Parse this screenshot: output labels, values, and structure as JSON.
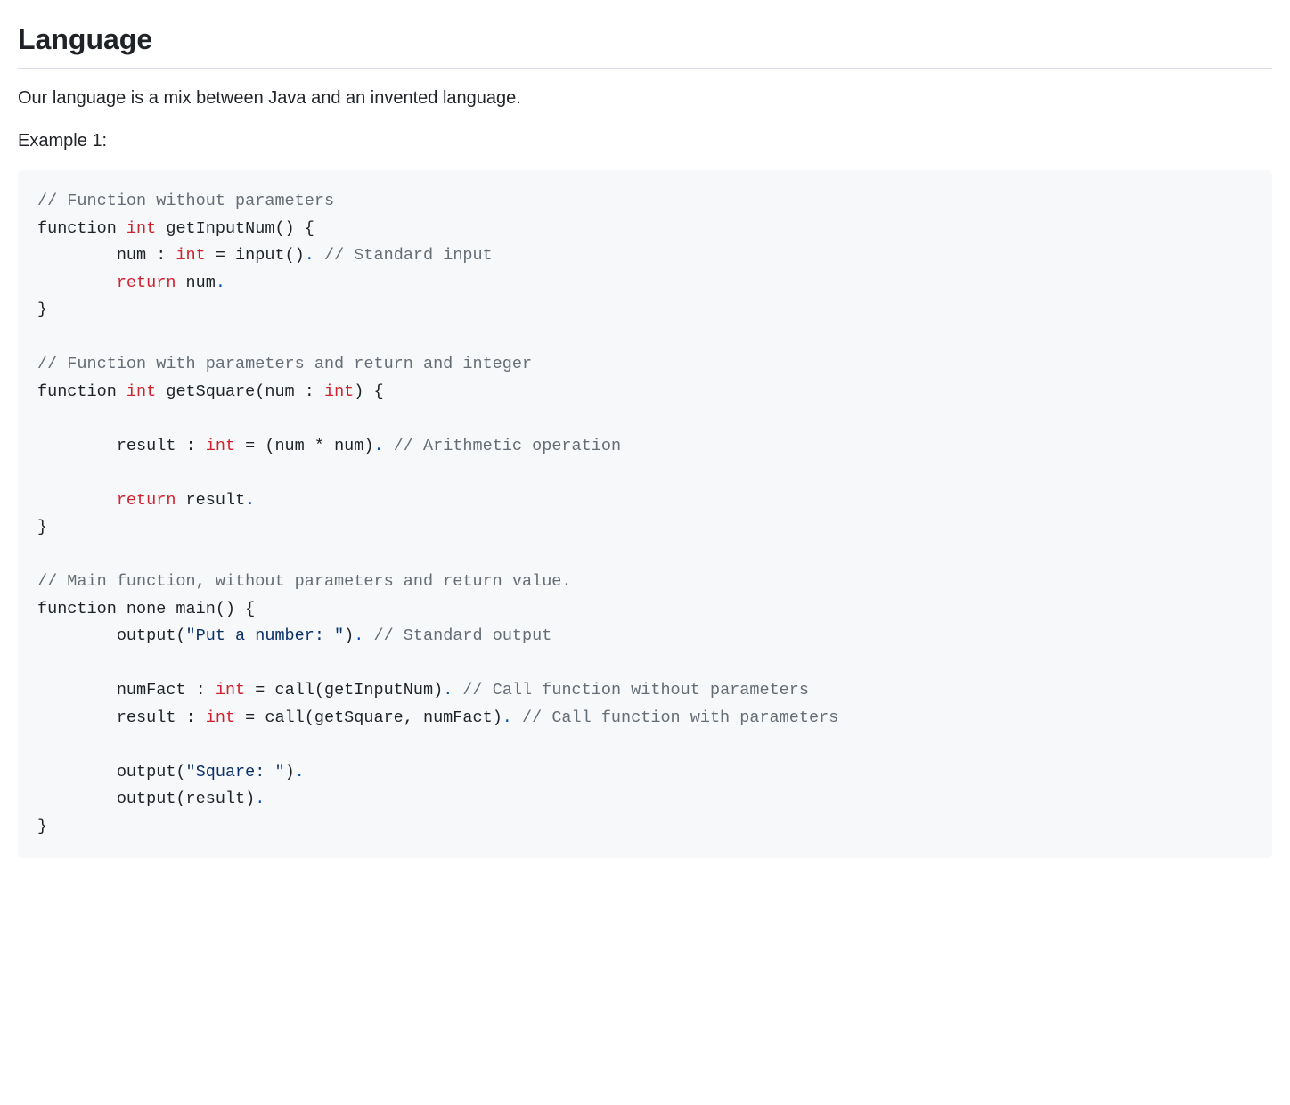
{
  "heading": "Language",
  "intro": "Our language is a mix between Java and an invented language.",
  "example_label": "Example 1:",
  "code": {
    "tokens": [
      {
        "cls": "tok-comment",
        "t": "// Function without parameters"
      },
      {
        "cls": null,
        "t": "\nfunction "
      },
      {
        "cls": "tok-keyword",
        "t": "int"
      },
      {
        "cls": null,
        "t": " getInputNum() {\n        num : "
      },
      {
        "cls": "tok-keyword",
        "t": "int"
      },
      {
        "cls": null,
        "t": " = input()"
      },
      {
        "cls": "tok-punct",
        "t": "."
      },
      {
        "cls": null,
        "t": " "
      },
      {
        "cls": "tok-comment",
        "t": "// Standard input"
      },
      {
        "cls": null,
        "t": "\n        "
      },
      {
        "cls": "tok-keyword",
        "t": "return"
      },
      {
        "cls": null,
        "t": " num"
      },
      {
        "cls": "tok-punct",
        "t": "."
      },
      {
        "cls": null,
        "t": "\n}\n\n"
      },
      {
        "cls": "tok-comment",
        "t": "// Function with parameters and return and integer"
      },
      {
        "cls": null,
        "t": "\nfunction "
      },
      {
        "cls": "tok-keyword",
        "t": "int"
      },
      {
        "cls": null,
        "t": " getSquare(num : "
      },
      {
        "cls": "tok-keyword",
        "t": "int"
      },
      {
        "cls": null,
        "t": ") {\n\n        result : "
      },
      {
        "cls": "tok-keyword",
        "t": "int"
      },
      {
        "cls": null,
        "t": " = (num * num)"
      },
      {
        "cls": "tok-punct",
        "t": "."
      },
      {
        "cls": null,
        "t": " "
      },
      {
        "cls": "tok-comment",
        "t": "// Arithmetic operation"
      },
      {
        "cls": null,
        "t": "\n\n        "
      },
      {
        "cls": "tok-keyword",
        "t": "return"
      },
      {
        "cls": null,
        "t": " result"
      },
      {
        "cls": "tok-punct",
        "t": "."
      },
      {
        "cls": null,
        "t": "\n}\n\n"
      },
      {
        "cls": "tok-comment",
        "t": "// Main function, without parameters and return value."
      },
      {
        "cls": null,
        "t": "\nfunction none main() {\n        output("
      },
      {
        "cls": "tok-string",
        "t": "\"Put a number: \""
      },
      {
        "cls": null,
        "t": ")"
      },
      {
        "cls": "tok-punct",
        "t": "."
      },
      {
        "cls": null,
        "t": " "
      },
      {
        "cls": "tok-comment",
        "t": "// Standard output"
      },
      {
        "cls": null,
        "t": "\n\n        numFact : "
      },
      {
        "cls": "tok-keyword",
        "t": "int"
      },
      {
        "cls": null,
        "t": " = call(getInputNum)"
      },
      {
        "cls": "tok-punct",
        "t": "."
      },
      {
        "cls": null,
        "t": " "
      },
      {
        "cls": "tok-comment",
        "t": "// Call function without parameters"
      },
      {
        "cls": null,
        "t": "\n        result : "
      },
      {
        "cls": "tok-keyword",
        "t": "int"
      },
      {
        "cls": null,
        "t": " = call(getSquare, numFact)"
      },
      {
        "cls": "tok-punct",
        "t": "."
      },
      {
        "cls": null,
        "t": " "
      },
      {
        "cls": "tok-comment",
        "t": "// Call function with parameters"
      },
      {
        "cls": null,
        "t": "\n\n        output("
      },
      {
        "cls": "tok-string",
        "t": "\"Square: \""
      },
      {
        "cls": null,
        "t": ")"
      },
      {
        "cls": "tok-punct",
        "t": "."
      },
      {
        "cls": null,
        "t": "\n        output(result)"
      },
      {
        "cls": "tok-punct",
        "t": "."
      },
      {
        "cls": null,
        "t": "\n}"
      }
    ]
  }
}
